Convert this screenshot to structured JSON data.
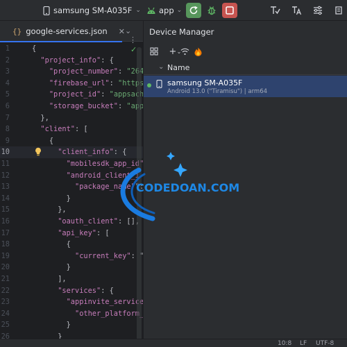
{
  "toolbar": {
    "device": "samsung SM-A035F",
    "app": "app"
  },
  "editor": {
    "tab_label": "google-services.json",
    "current_line": 10,
    "lines": [
      {
        "n": "1",
        "indent": "",
        "parts": [
          [
            "p",
            "{"
          ]
        ]
      },
      {
        "n": "2",
        "indent": "  ",
        "parts": [
          [
            "k",
            "\"project_info\""
          ],
          [
            "p",
            ": {"
          ]
        ]
      },
      {
        "n": "3",
        "indent": "    ",
        "parts": [
          [
            "k",
            "\"project_number\""
          ],
          [
            "p",
            ": "
          ],
          [
            "s",
            "\"264"
          ]
        ]
      },
      {
        "n": "4",
        "indent": "    ",
        "parts": [
          [
            "k",
            "\"firebase_url\""
          ],
          [
            "p",
            ": "
          ],
          [
            "s",
            "\"https"
          ]
        ]
      },
      {
        "n": "5",
        "indent": "    ",
        "parts": [
          [
            "k",
            "\"project_id\""
          ],
          [
            "p",
            ": "
          ],
          [
            "s",
            "\"appsach"
          ]
        ]
      },
      {
        "n": "6",
        "indent": "    ",
        "parts": [
          [
            "k",
            "\"storage_bucket\""
          ],
          [
            "p",
            ": "
          ],
          [
            "s",
            "\"app"
          ]
        ]
      },
      {
        "n": "7",
        "indent": "  ",
        "parts": [
          [
            "p",
            "},"
          ]
        ]
      },
      {
        "n": "8",
        "indent": "  ",
        "parts": [
          [
            "k",
            "\"client\""
          ],
          [
            "p",
            ": ["
          ]
        ]
      },
      {
        "n": "9",
        "indent": "    ",
        "parts": [
          [
            "p",
            "{"
          ]
        ]
      },
      {
        "n": "10",
        "indent": "      ",
        "parts": [
          [
            "k",
            "\"client_info\""
          ],
          [
            "p",
            ": {"
          ]
        ]
      },
      {
        "n": "11",
        "indent": "        ",
        "parts": [
          [
            "k",
            "\"mobilesdk_app_id\""
          ]
        ]
      },
      {
        "n": "12",
        "indent": "        ",
        "parts": [
          [
            "k",
            "\"android_client_i"
          ]
        ]
      },
      {
        "n": "13",
        "indent": "          ",
        "parts": [
          [
            "k",
            "\"package_name\""
          ],
          [
            "p",
            "\":"
          ]
        ]
      },
      {
        "n": "14",
        "indent": "        ",
        "parts": [
          [
            "p",
            "}"
          ]
        ]
      },
      {
        "n": "15",
        "indent": "      ",
        "parts": [
          [
            "p",
            "},"
          ]
        ]
      },
      {
        "n": "16",
        "indent": "      ",
        "parts": [
          [
            "k",
            "\"oauth_client\""
          ],
          [
            "p",
            ": [],"
          ]
        ]
      },
      {
        "n": "17",
        "indent": "      ",
        "parts": [
          [
            "k",
            "\"api_key\""
          ],
          [
            "p",
            ": ["
          ]
        ]
      },
      {
        "n": "18",
        "indent": "        ",
        "parts": [
          [
            "p",
            "{"
          ]
        ]
      },
      {
        "n": "19",
        "indent": "          ",
        "parts": [
          [
            "k",
            "\"current_key\""
          ],
          [
            "p",
            ": \""
          ]
        ]
      },
      {
        "n": "20",
        "indent": "        ",
        "parts": [
          [
            "p",
            "}"
          ]
        ]
      },
      {
        "n": "21",
        "indent": "      ",
        "parts": [
          [
            "p",
            "],"
          ]
        ]
      },
      {
        "n": "22",
        "indent": "      ",
        "parts": [
          [
            "k",
            "\"services\""
          ],
          [
            "p",
            ": {"
          ]
        ]
      },
      {
        "n": "23",
        "indent": "        ",
        "parts": [
          [
            "k",
            "\"appinvite_service"
          ]
        ]
      },
      {
        "n": "24",
        "indent": "          ",
        "parts": [
          [
            "k",
            "\"other_platform_o"
          ]
        ]
      },
      {
        "n": "25",
        "indent": "        ",
        "parts": [
          [
            "p",
            "}"
          ]
        ]
      },
      {
        "n": "26",
        "indent": "      ",
        "parts": [
          [
            "p",
            "}"
          ]
        ]
      }
    ]
  },
  "device_manager": {
    "title": "Device Manager",
    "column_name": "Name",
    "device": {
      "name": "samsung SM-A035F",
      "details": "Android 13.0 (\"Tiramisu\") | arm64"
    }
  },
  "status_bar": {
    "position": "10:8",
    "line_separator": "LF",
    "encoding": "UTF-8"
  },
  "watermark": {
    "text": "CODEDOAN.COM"
  },
  "colors": {
    "keyword": "#c77dbb",
    "string": "#6aab73",
    "selection": "#2e436e",
    "run_green": "#57965c",
    "stop_red": "#c75450"
  }
}
